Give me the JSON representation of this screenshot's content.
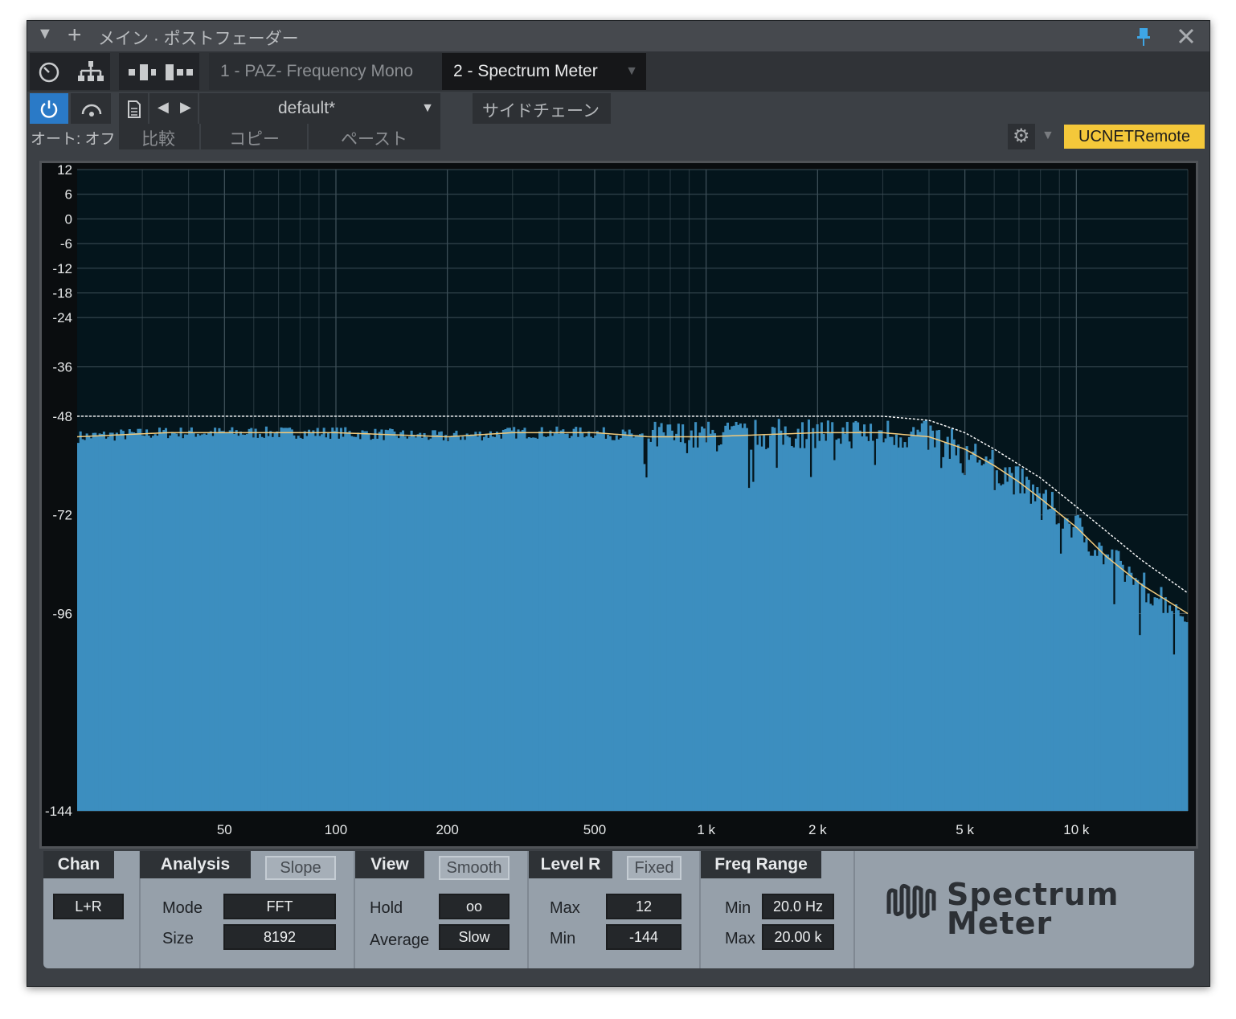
{
  "window": {
    "title": "メイン · ポストフェーダー"
  },
  "tabs": [
    {
      "label": "1 - PAZ- Frequency Mono"
    },
    {
      "label": "2 - Spectrum Meter"
    }
  ],
  "toolbar": {
    "preset": "default*",
    "sidechain": "サイドチェーン",
    "auto": "オート: オフ",
    "compare": "比較",
    "copy": "コピー",
    "paste": "ペースト",
    "remote": "UCNETRemote"
  },
  "colors": {
    "spectrum_fill": "#3c8ebf",
    "peak_line": "#ffffff",
    "avg_line": "#f2c97a",
    "remote_badge": "#f4c83a",
    "power_active": "#2a7ac7"
  },
  "chart_data": {
    "type": "area",
    "x_scale": "log",
    "xlim": [
      20,
      20000
    ],
    "ylim": [
      -144,
      12
    ],
    "grid": true,
    "y_ticks": [
      12,
      6,
      0,
      -6,
      -12,
      -18,
      -24,
      -36,
      -48,
      -72,
      -96,
      -144
    ],
    "x_tick_labels": [
      "50",
      "100",
      "200",
      "500",
      "1 k",
      "2 k",
      "5 k",
      "10 k"
    ],
    "x_tick_values": [
      50,
      100,
      200,
      500,
      1000,
      2000,
      5000,
      10000
    ],
    "series": [
      {
        "values_x": [
          20,
          35,
          50,
          100,
          200,
          300,
          500,
          700,
          1000,
          2000,
          3000,
          4000,
          5000,
          6000,
          7000,
          8000,
          10000,
          12000,
          15000,
          20000
        ],
        "values_y": [
          -53,
          -52,
          -52,
          -52,
          -53,
          -52,
          -52,
          -53,
          -53,
          -52,
          -52,
          -53,
          -56,
          -60,
          -64,
          -68,
          -75,
          -82,
          -89,
          -96
        ]
      },
      {
        "values_x": [
          20,
          50,
          100,
          200,
          500,
          1000,
          2000,
          3000,
          4000,
          5000,
          6000,
          8000,
          10000,
          15000,
          20000
        ],
        "values_y": [
          -48,
          -48,
          -48,
          -48,
          -48,
          -48,
          -48,
          -48,
          -49,
          -52,
          -56,
          -63,
          -70,
          -83,
          -91
        ]
      }
    ]
  },
  "panels": {
    "chan": {
      "title": "Chan",
      "value": "L+R"
    },
    "analysis": {
      "title": "Analysis",
      "toggle": "Slope",
      "mode_label": "Mode",
      "mode_value": "FFT",
      "size_label": "Size",
      "size_value": "8192"
    },
    "view": {
      "title": "View",
      "toggle": "Smooth",
      "hold_label": "Hold",
      "hold_value": "oo",
      "average_label": "Average",
      "average_value": "Slow"
    },
    "level": {
      "title": "Level R",
      "toggle": "Fixed",
      "max_label": "Max",
      "max_value": "12",
      "min_label": "Min",
      "min_value": "-144"
    },
    "freq": {
      "title": "Freq Range",
      "min_label": "Min",
      "min_value": "20.0 Hz",
      "max_label": "Max",
      "max_value": "20.00 k"
    }
  },
  "logo": {
    "line1": "Spectrum",
    "line2": "Meter"
  }
}
